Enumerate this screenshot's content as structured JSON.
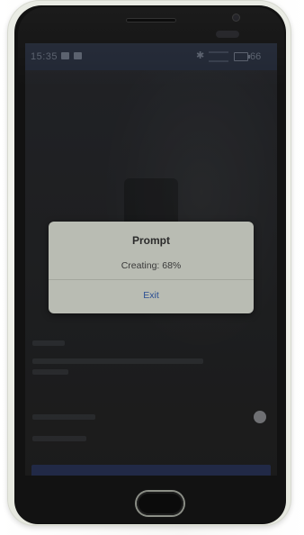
{
  "statusbar": {
    "time": "15:35",
    "battery_level": "66"
  },
  "dialog": {
    "title": "Prompt",
    "message": "Creating: 68%",
    "exit_label": "Exit"
  },
  "colors": {
    "dialog_bg": "#b9bcb3",
    "exit_text": "#2b4f93",
    "statusbar_bg": "#2e3748",
    "screen_dim": "#2b2c2e"
  },
  "icons": {
    "status_left": [
      "image-icon",
      "message-icon"
    ],
    "status_right": [
      "bluetooth-icon",
      "battery-icon"
    ]
  }
}
